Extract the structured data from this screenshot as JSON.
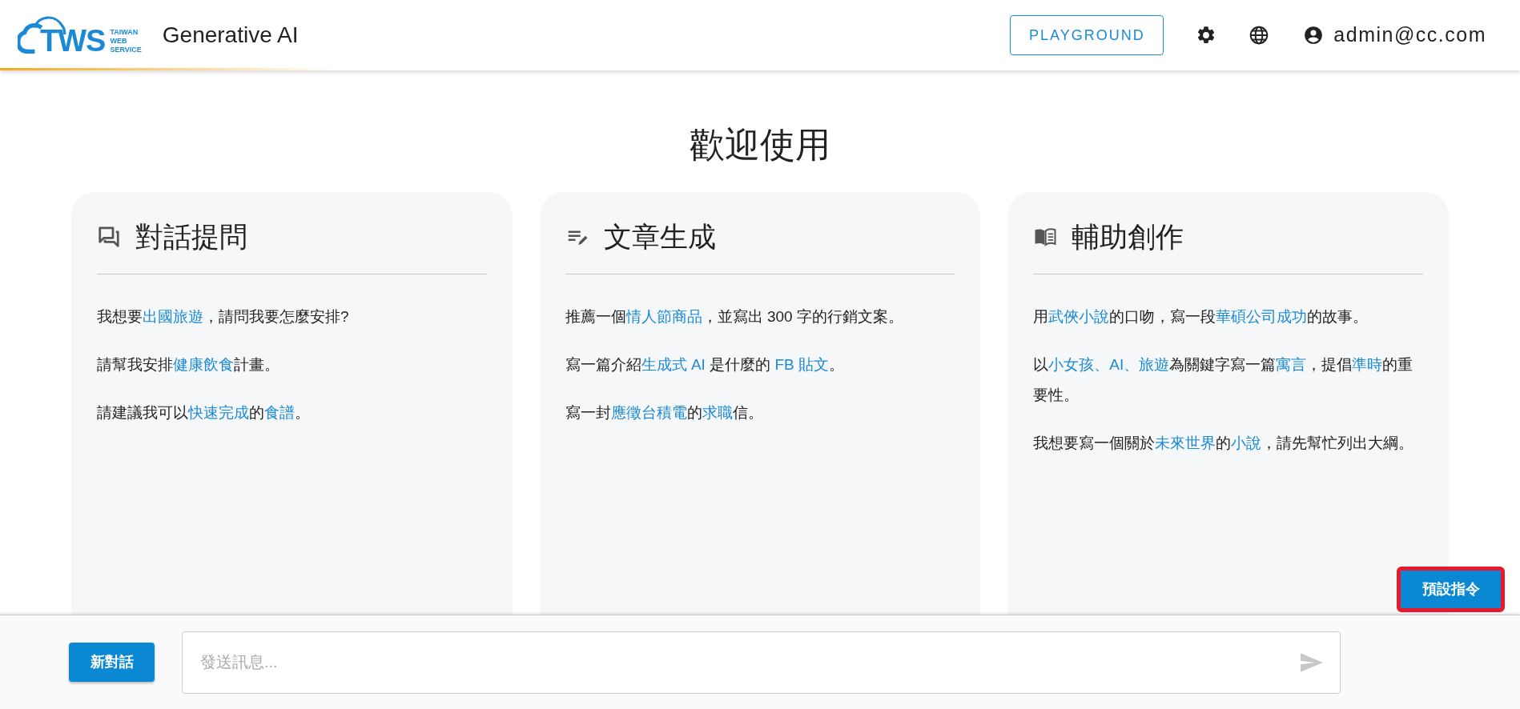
{
  "header": {
    "logo": {
      "mark": "TWS",
      "lines": [
        "TAIWAN",
        "WEB",
        "SERVICE"
      ]
    },
    "app_title": "Generative AI",
    "playground_button": "PLAYGROUND",
    "user": "admin@cc.com"
  },
  "welcome_title": "歡迎使用",
  "cards": [
    {
      "kind": "chat",
      "title": "對話提問",
      "prompts": [
        [
          {
            "text": "我想要",
            "link": false
          },
          {
            "text": "出國旅遊",
            "link": true
          },
          {
            "text": "，請問我要怎麼安排?",
            "link": false
          }
        ],
        [
          {
            "text": "請幫我安排",
            "link": false
          },
          {
            "text": "健康飲食",
            "link": true
          },
          {
            "text": "計畫。",
            "link": false
          }
        ],
        [
          {
            "text": "請建議我可以",
            "link": false
          },
          {
            "text": "快速完成",
            "link": true
          },
          {
            "text": "的",
            "link": false
          },
          {
            "text": "食譜",
            "link": true
          },
          {
            "text": "。",
            "link": false
          }
        ]
      ]
    },
    {
      "kind": "article",
      "title": "文章生成",
      "prompts": [
        [
          {
            "text": "推薦一個",
            "link": false
          },
          {
            "text": "情人節商品",
            "link": true
          },
          {
            "text": "，並寫出 300 字的行銷文案。",
            "link": false
          }
        ],
        [
          {
            "text": "寫一篇介紹",
            "link": false
          },
          {
            "text": "生成式 AI",
            "link": true
          },
          {
            "text": " 是什麼的 ",
            "link": false
          },
          {
            "text": "FB 貼文",
            "link": true
          },
          {
            "text": "。",
            "link": false
          }
        ],
        [
          {
            "text": "寫一封",
            "link": false
          },
          {
            "text": "應徵台積電",
            "link": true
          },
          {
            "text": "的",
            "link": false
          },
          {
            "text": "求職",
            "link": true
          },
          {
            "text": "信。",
            "link": false
          }
        ]
      ]
    },
    {
      "kind": "book",
      "title": "輔助創作",
      "prompts": [
        [
          {
            "text": "用",
            "link": false
          },
          {
            "text": "武俠小說",
            "link": true
          },
          {
            "text": "的口吻，寫一段",
            "link": false
          },
          {
            "text": "華碩公司成功",
            "link": true
          },
          {
            "text": "的故事。",
            "link": false
          }
        ],
        [
          {
            "text": "以",
            "link": false
          },
          {
            "text": "小女孩、AI、旅遊",
            "link": true
          },
          {
            "text": "為關鍵字寫一篇",
            "link": false
          },
          {
            "text": "寓言",
            "link": true
          },
          {
            "text": "，提倡",
            "link": false
          },
          {
            "text": "準時",
            "link": true
          },
          {
            "text": "的重要性。",
            "link": false
          }
        ],
        [
          {
            "text": "我想要寫一個關於",
            "link": false
          },
          {
            "text": "未來世界",
            "link": true
          },
          {
            "text": "的",
            "link": false
          },
          {
            "text": "小說",
            "link": true
          },
          {
            "text": "，請先幫忙列出大綱。",
            "link": false
          }
        ]
      ]
    }
  ],
  "bottom_bar": {
    "new_chat_button": "新對話",
    "message_field": {
      "placeholder": "發送訊息..."
    },
    "preset_button": {
      "label": "預設指令",
      "highlighted": true
    }
  }
}
